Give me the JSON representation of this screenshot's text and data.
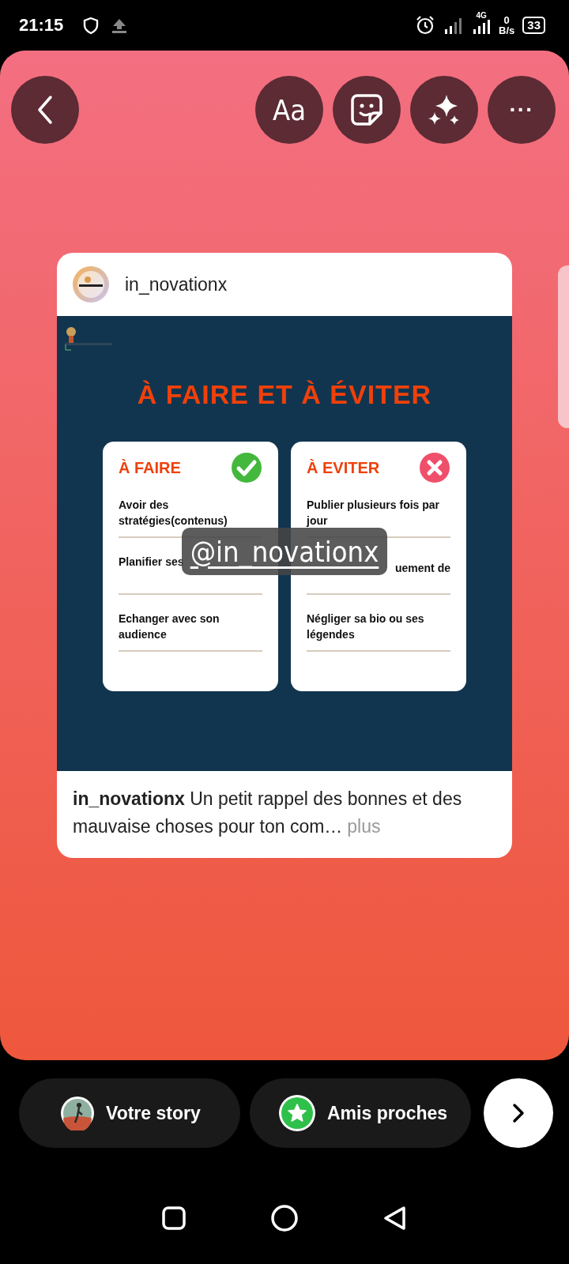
{
  "status_bar": {
    "time": "21:15",
    "network": "4G",
    "speed_value": "0",
    "speed_unit": "B/s",
    "battery": "33"
  },
  "toolbar": {
    "text_button": "Aa",
    "more_button": "···"
  },
  "post": {
    "username": "in_novationx",
    "image": {
      "title": "À FAIRE ET À ÉVITER",
      "columns": [
        {
          "kind": "do",
          "heading": "À FAIRE",
          "items": [
            "Avoir des stratégies(contenus)",
            "Planifier ses",
            "Echanger avec son audience"
          ]
        },
        {
          "kind": "avoid",
          "heading": "À EVITER",
          "items": [
            "Publier plusieurs fois par jour",
            "uement de",
            "Négliger sa bio ou ses légendes"
          ]
        }
      ]
    },
    "caption": "**in_novationx** Un petit rappel des bonnes et des mauvaise choses pour ton com…",
    "more": "plus"
  },
  "sticker": "@in_novationx",
  "share": [
    {
      "kind": "story",
      "label": "Votre story"
    },
    {
      "kind": "close_friends",
      "label": "Amis proches"
    }
  ]
}
